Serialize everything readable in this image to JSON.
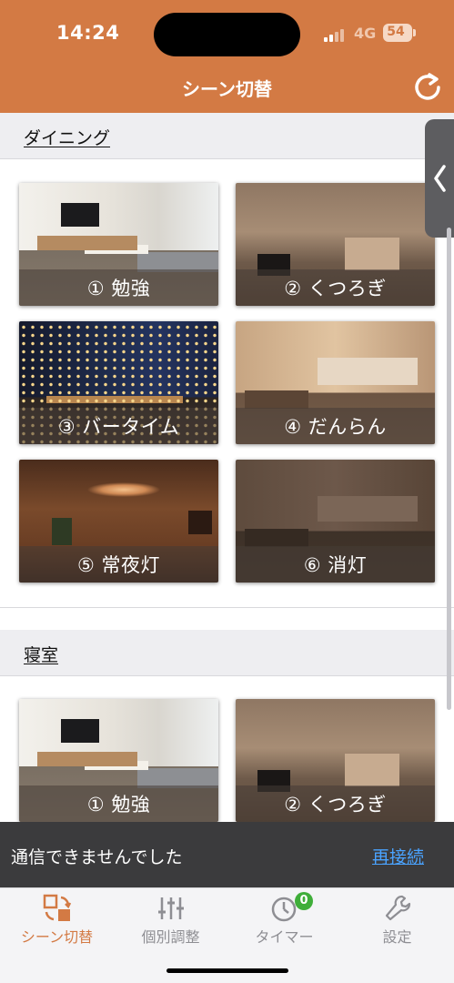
{
  "status_bar": {
    "time": "14:24",
    "network": "4G",
    "battery": "54"
  },
  "nav": {
    "title": "シーン切替",
    "refresh_icon": "refresh-icon"
  },
  "sections": [
    {
      "title": "ダイニング",
      "scenes": [
        {
          "label": "① 勉強"
        },
        {
          "label": "② くつろぎ"
        },
        {
          "label": "③ バータイム"
        },
        {
          "label": "④ だんらん"
        },
        {
          "label": "⑤ 常夜灯"
        },
        {
          "label": "⑥ 消灯"
        }
      ]
    },
    {
      "title": "寝室",
      "scenes": [
        {
          "label": "① 勉強"
        },
        {
          "label": "② くつろぎ"
        }
      ]
    }
  ],
  "banner": {
    "message": "通信できませんでした",
    "action": "再接続"
  },
  "tabbar": {
    "tabs": [
      {
        "label": "シーン切替",
        "icon": "scene-switch-icon",
        "active": true
      },
      {
        "label": "個別調整",
        "icon": "sliders-icon",
        "active": false
      },
      {
        "label": "タイマー",
        "icon": "timer-icon",
        "active": false,
        "badge": "0"
      },
      {
        "label": "設定",
        "icon": "wrench-icon",
        "active": false
      }
    ]
  },
  "colors": {
    "accent": "#d37a44",
    "banner_link": "#4aa3ff",
    "badge": "#3fae3a"
  }
}
